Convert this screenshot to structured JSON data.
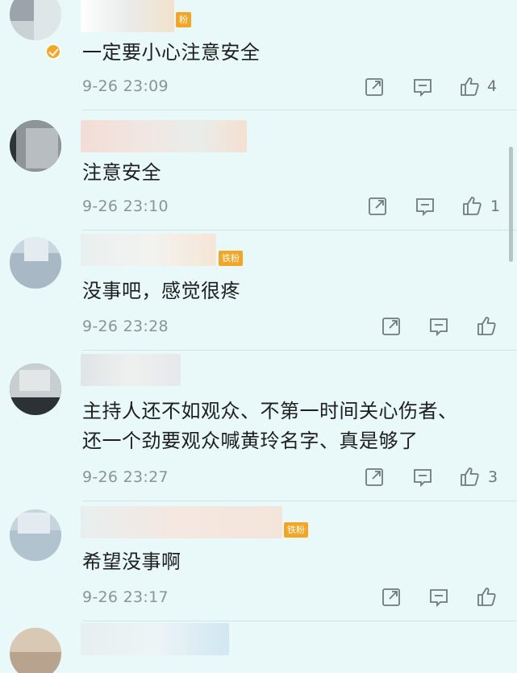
{
  "comments": [
    {
      "text": "一定要小心注意安全",
      "time": "9-26 23:09",
      "likes": "4",
      "badge": "粉"
    },
    {
      "text": "注意安全",
      "time": "9-26 23:10",
      "likes": "1"
    },
    {
      "text": "没事吧，感觉很疼",
      "time": "9-26 23:28",
      "likes": "",
      "badge": "铁粉"
    },
    {
      "text_line1": "主持人还不如观众、不第一时间关心伤者、",
      "text_line2": "还一个劲要观众喊黄玲名字、真是够了",
      "time": "9-26 23:27",
      "likes": "3"
    },
    {
      "text": "希望没事啊",
      "time": "9-26 23:17",
      "likes": "",
      "badge": "铁粉"
    }
  ],
  "icons": {
    "share": "share-icon",
    "reply": "comment-icon",
    "like": "thumbs-up-icon",
    "verified": "verified-badge-icon"
  },
  "colors": {
    "background": "#e9f9f9",
    "badge": "#f5a524",
    "meta_text": "#8a9494"
  }
}
